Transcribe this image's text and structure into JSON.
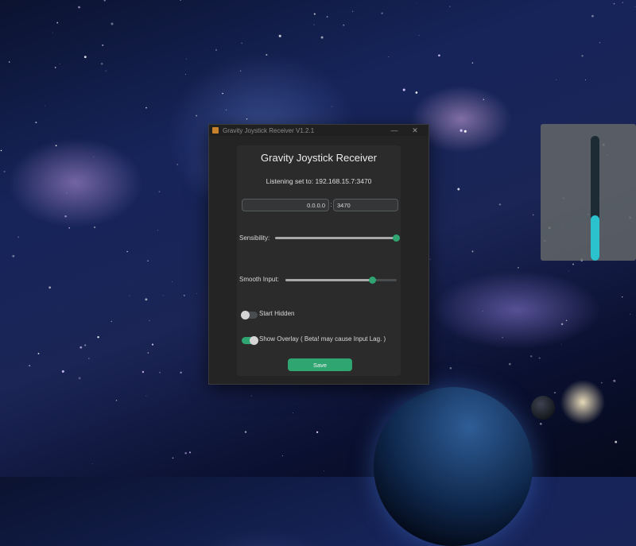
{
  "window": {
    "title": "Gravity Joystick Receiver V1.2.1",
    "minimize_glyph": "—",
    "close_glyph": "✕"
  },
  "app": {
    "heading": "Gravity Joystick Receiver",
    "listening_text": "Listening set to: 192.168.15.7:3470",
    "ip_value": "0.0.0.0",
    "separator": ":",
    "port_value": "3470"
  },
  "settings": {
    "sensibility": {
      "label": "Sensibility:",
      "value": 1.0
    },
    "smooth_input": {
      "label": "Smooth Input:",
      "value": 0.78
    },
    "start_hidden": {
      "label": "Start Hidden",
      "on": false
    },
    "show_overlay": {
      "label": "Show Overlay ( Beta! may cause Input Lag. )",
      "on": true
    }
  },
  "save_label": "Save",
  "overlay": {
    "level": 0.36
  },
  "colors": {
    "accent": "#2fa572",
    "overlay_fill": "#2bc1cd",
    "window_bg": "#242424",
    "panel_bg": "#2b2b2b"
  },
  "icons": {
    "app": "joystick-app-icon",
    "minimize": "minimize-icon",
    "close": "close-icon"
  }
}
